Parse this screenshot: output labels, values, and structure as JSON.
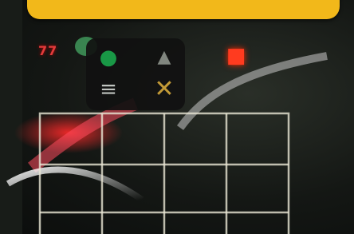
{
  "top_banner": {
    "text": ""
  },
  "hud": {
    "score_text": "77"
  },
  "button_panel": {
    "buttons": [
      {
        "name": "circle",
        "glyph": "●",
        "color": "#1aa34a"
      },
      {
        "name": "triangle",
        "glyph": "▲",
        "color": "#8a8f88"
      },
      {
        "name": "square",
        "glyph": "■",
        "color": "#ff3b1f"
      },
      {
        "name": "menu-bars",
        "glyph": "≡",
        "color": "#cfd3cf"
      },
      {
        "name": "cross",
        "glyph": "✕",
        "color": "#d1a53a"
      }
    ]
  },
  "board": {
    "columns": 4,
    "rows": 3
  },
  "colors": {
    "banner": "#f2b81a",
    "panel": "#111111",
    "grid": "#e9e6d4"
  }
}
